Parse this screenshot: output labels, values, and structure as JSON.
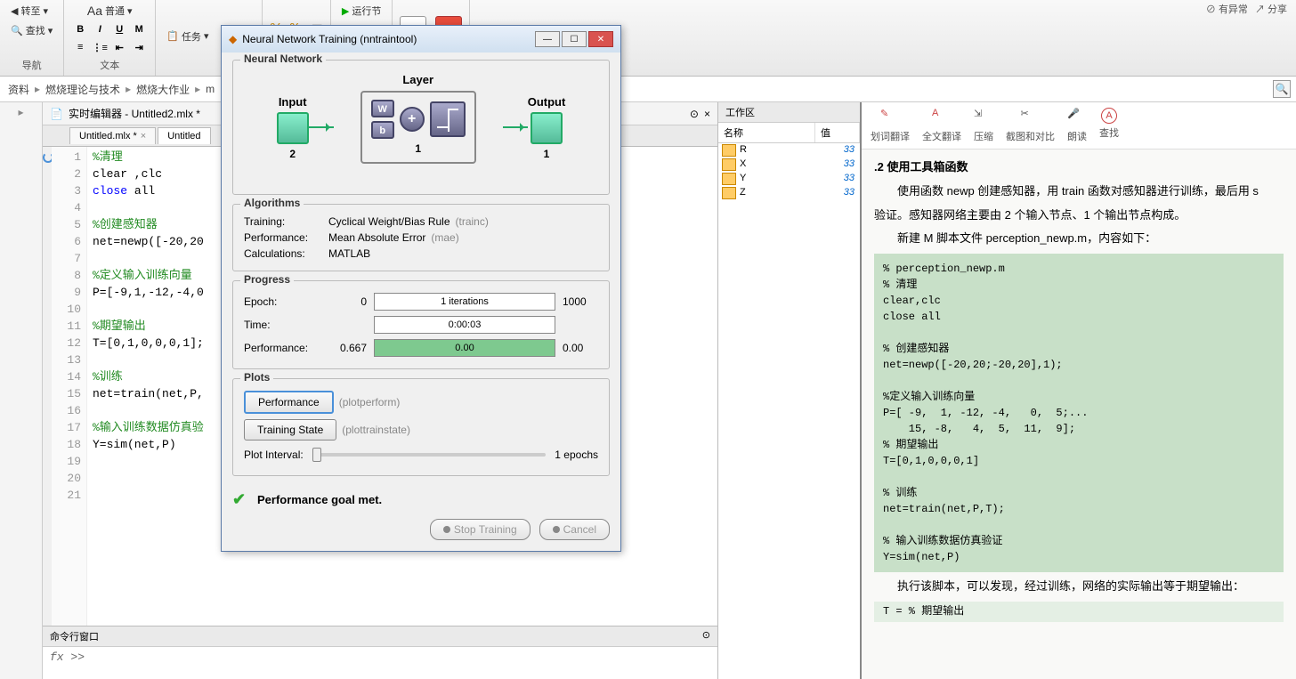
{
  "ribbon": {
    "goto": "转至",
    "find": "查找",
    "nav_label": "导航",
    "normal": "普通",
    "text": "文本",
    "text_label": "文本",
    "bold": "B",
    "italic": "I",
    "underline": "U",
    "mono": "M",
    "task": "任务",
    "section_label": "节",
    "runsection": "运行节",
    "run_label": "运行",
    "share_top": "有异常",
    "share": "分享"
  },
  "breadcrumb": {
    "items": [
      "资料",
      "燃烧理论与技术",
      "燃烧大作业",
      "m"
    ]
  },
  "editor": {
    "title": "实时编辑器 - Untitled2.mlx *",
    "tabs": [
      {
        "label": "Untitled.mlx *"
      },
      {
        "label": "Untitled"
      }
    ]
  },
  "code_lines": [
    {
      "n": 1,
      "t": "%清理",
      "cls": "cmt"
    },
    {
      "n": 2,
      "t": "clear ,clc"
    },
    {
      "n": 3,
      "t": "close all",
      "kw": "close",
      "rest": " all"
    },
    {
      "n": 4,
      "t": ""
    },
    {
      "n": 5,
      "t": "%创建感知器",
      "cls": "cmt"
    },
    {
      "n": 6,
      "t": "net=newp([-20,20"
    },
    {
      "n": 7,
      "t": ""
    },
    {
      "n": 8,
      "t": "%定义输入训练向量",
      "cls": "cmt"
    },
    {
      "n": 9,
      "t": "P=[-9,1,-12,-4,0"
    },
    {
      "n": 10,
      "t": ""
    },
    {
      "n": 11,
      "t": "%期望输出",
      "cls": "cmt"
    },
    {
      "n": 12,
      "t": "T=[0,1,0,0,0,1];"
    },
    {
      "n": 13,
      "t": ""
    },
    {
      "n": 14,
      "t": "%训练",
      "cls": "cmt"
    },
    {
      "n": 15,
      "t": "net=train(net,P,"
    },
    {
      "n": 16,
      "t": ""
    },
    {
      "n": 17,
      "t": "%输入训练数据仿真验",
      "cls": "cmt"
    },
    {
      "n": 18,
      "t": "Y=sim(net,P)"
    },
    {
      "n": 19,
      "t": ""
    },
    {
      "n": 20,
      "t": ""
    },
    {
      "n": 21,
      "t": ""
    }
  ],
  "cmd": {
    "title": "命令行窗口",
    "prompt": "fx >>"
  },
  "workspace": {
    "title": "工作区",
    "cols": {
      "name": "名称",
      "value": "值"
    },
    "vars": [
      {
        "name": "R",
        "val": "33"
      },
      {
        "name": "X",
        "val": "33"
      },
      {
        "name": "Y",
        "val": "33"
      },
      {
        "name": "Z",
        "val": "33"
      }
    ]
  },
  "doc": {
    "tools": {
      "translate_sel": "划词翻译",
      "translate_all": "全文翻译",
      "compress": "压缩",
      "screenshot": "截图和对比",
      "read": "朗读",
      "find": "查找"
    },
    "heading": ".2  使用工具箱函数",
    "para1": "使用函数 newp 创建感知器，用 train 函数对感知器进行训练，最后用 s",
    "para2": "验证。感知器网络主要由 2 个输入节点、1 个输出节点构成。",
    "para3": "新建 M 脚本文件 perception_newp.m，内容如下：",
    "code": "% perception_newp.m\n% 清理\nclear,clc\nclose all\n\n% 创建感知器\nnet=newp([-20,20;-20,20],1);\n\n%定义输入训练向量\nP=[ -9,  1, -12, -4,   0,  5;...\n    15, -8,   4,  5,  11,  9];\n% 期望输出\nT=[0,1,0,0,0,1]\n\n% 训练\nnet=train(net,P,T);\n\n% 输入训练数据仿真验证\nY=sim(net,P)",
    "para4": "执行该脚本，可以发现，经过训练，网络的实际输出等于期望输出：",
    "code2": "T =          % 期望输出"
  },
  "dialog": {
    "title": "Neural Network Training (nntraintool)",
    "sections": {
      "nn": "Neural Network",
      "algo": "Algorithms",
      "progress": "Progress",
      "plots": "Plots"
    },
    "diagram": {
      "input": "Input",
      "layer": "Layer",
      "output": "Output",
      "in_n": "2",
      "layer_n": "1",
      "out_n": "1",
      "w": "W",
      "b": "b"
    },
    "algo": {
      "training_l": "Training:",
      "training_v": "Cyclical Weight/Bias Rule",
      "training_h": "(trainc)",
      "perf_l": "Performance:",
      "perf_v": "Mean Absolute Error",
      "perf_h": "(mae)",
      "calc_l": "Calculations:",
      "calc_v": "MATLAB"
    },
    "progress": {
      "epoch_l": "Epoch:",
      "epoch_left": "0",
      "epoch_text": "1 iterations",
      "epoch_right": "1000",
      "time_l": "Time:",
      "time_text": "0:00:03",
      "perf_l": "Performance:",
      "perf_left": "0.667",
      "perf_text": "0.00",
      "perf_right": "0.00"
    },
    "plots": {
      "performance": "Performance",
      "performance_h": "(plotperform)",
      "trainstate": "Training State",
      "trainstate_h": "(plottrainstate)",
      "interval_l": "Plot Interval:",
      "interval_v": "1 epochs"
    },
    "status": "Performance goal met.",
    "buttons": {
      "stop": "Stop Training",
      "cancel": "Cancel"
    }
  }
}
